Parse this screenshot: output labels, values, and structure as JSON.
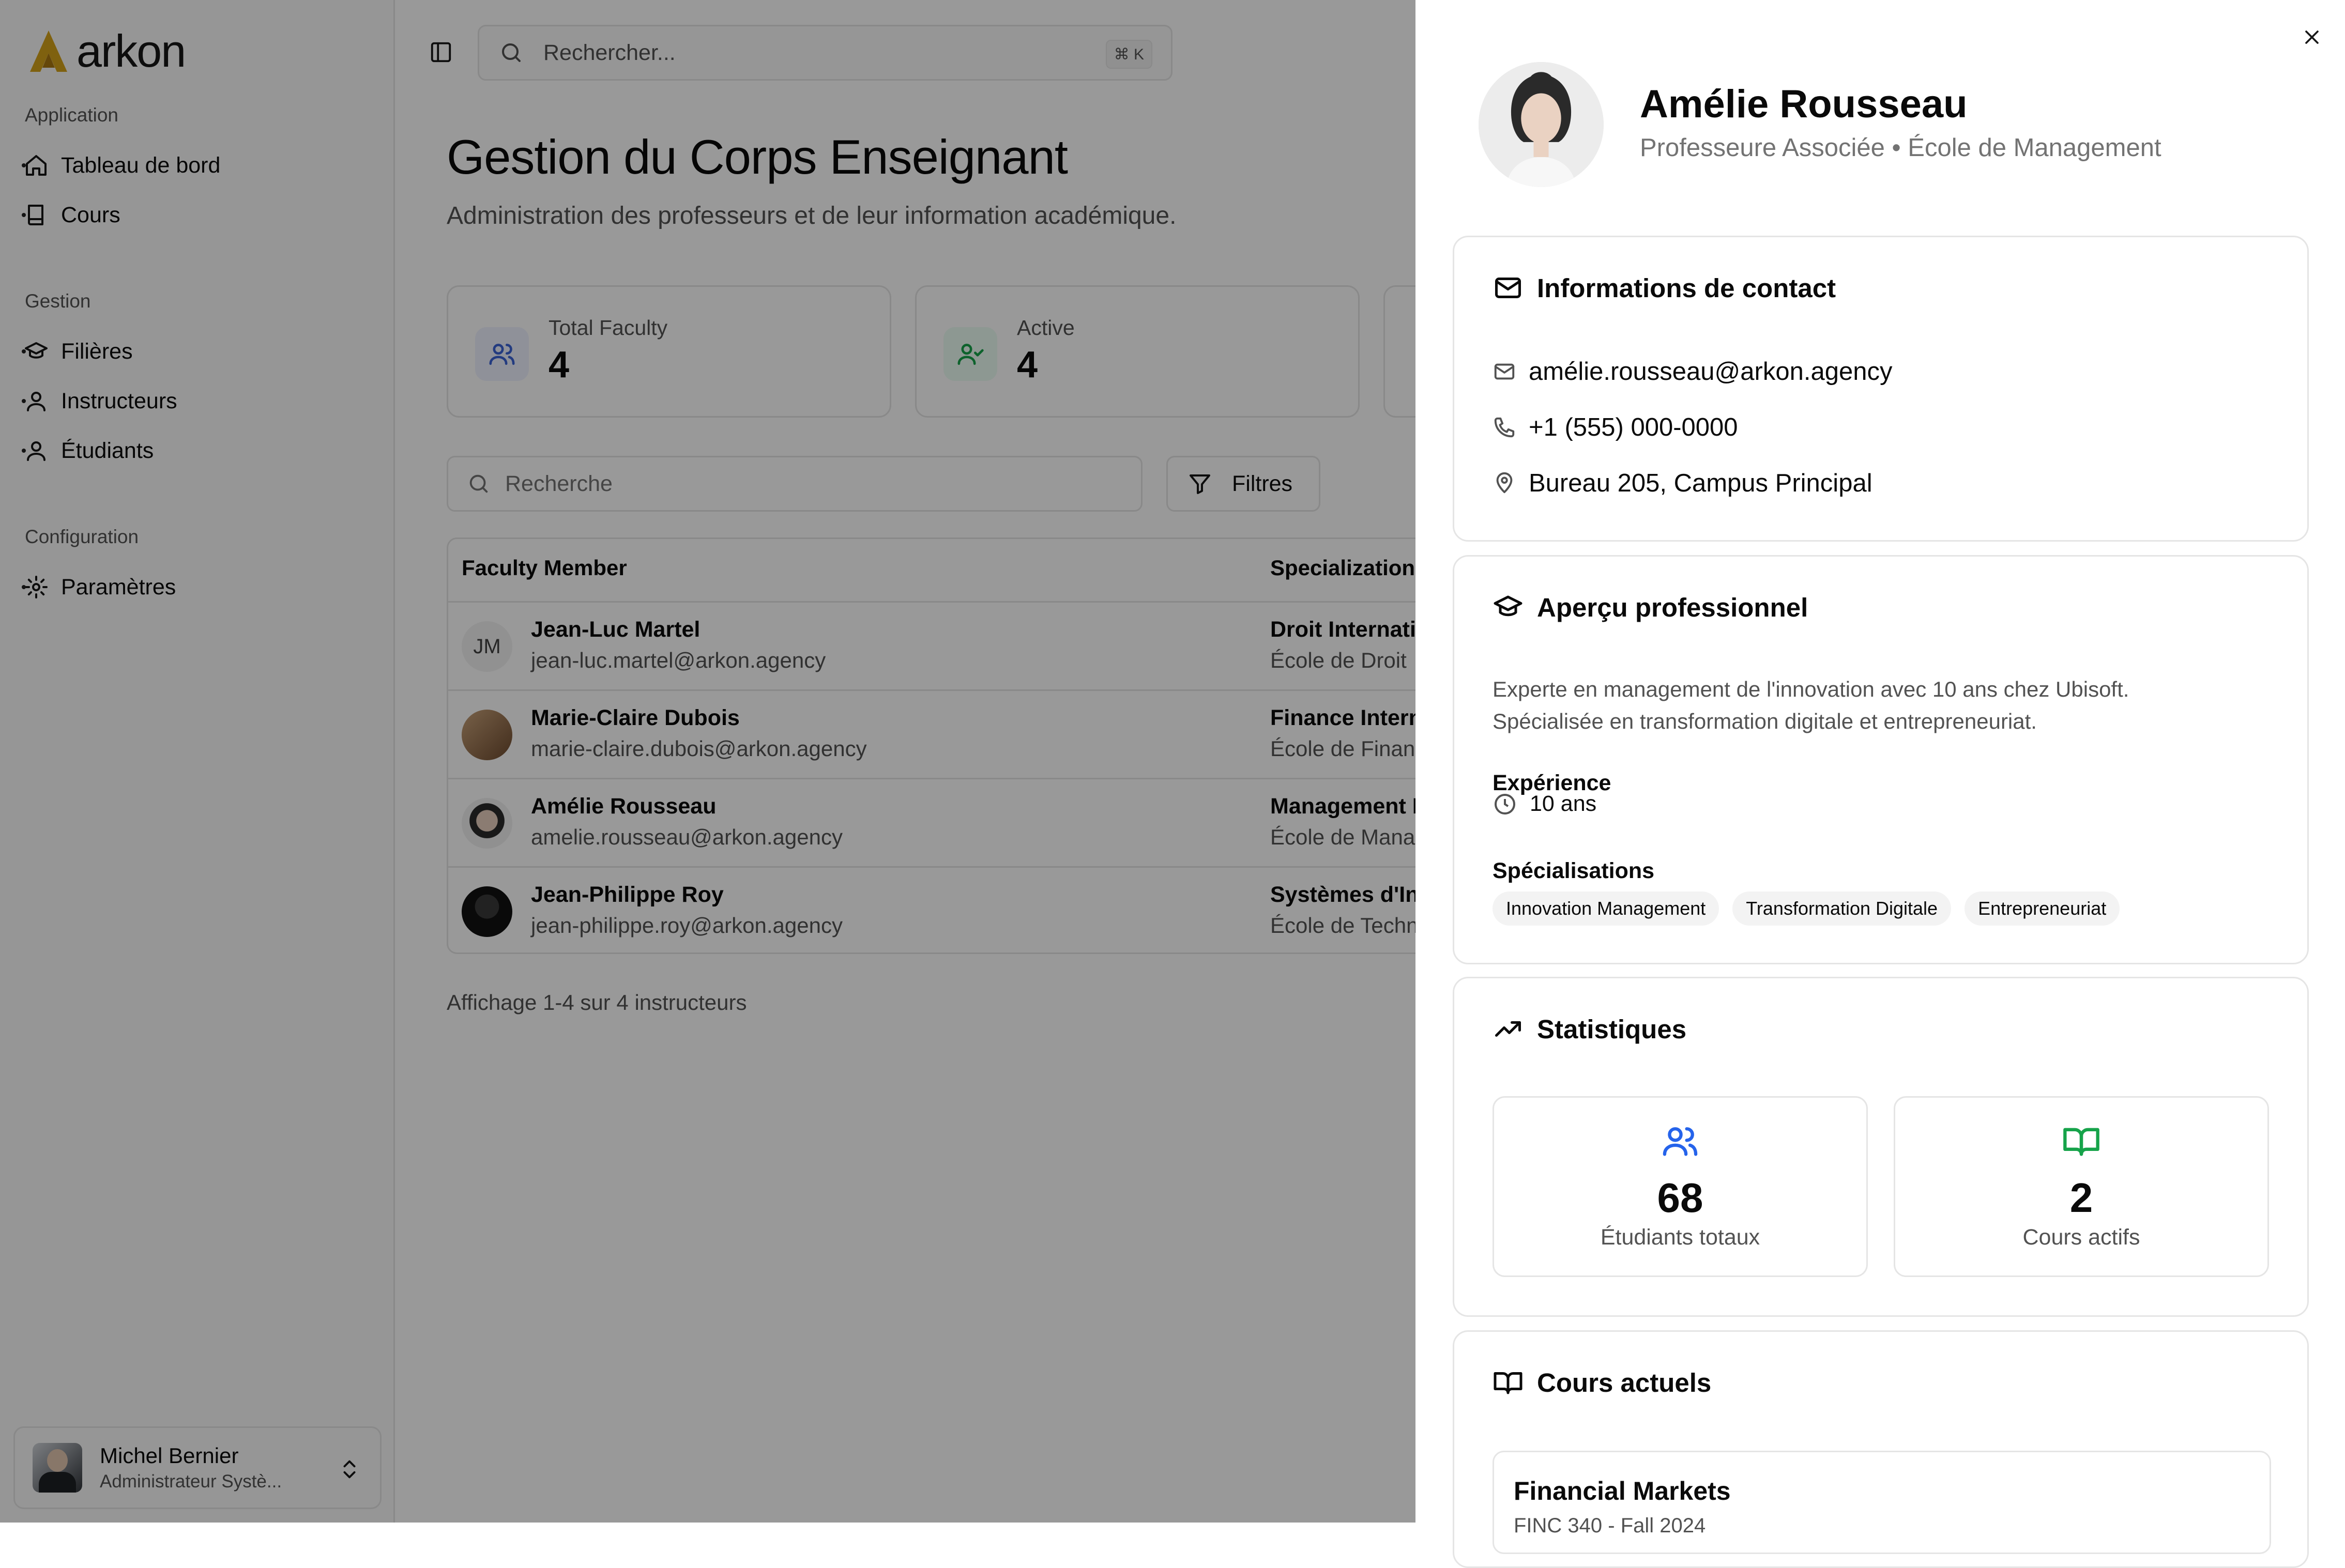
{
  "brand": {
    "name": "arkon",
    "accent": "#d4a21a"
  },
  "sidebar": {
    "sections": [
      {
        "label": "Application",
        "items": [
          {
            "label": "Tableau de bord",
            "icon": "home-icon"
          },
          {
            "label": "Cours",
            "icon": "book-icon"
          }
        ]
      },
      {
        "label": "Gestion",
        "items": [
          {
            "label": "Filières",
            "icon": "graduation-cap-icon"
          },
          {
            "label": "Instructeurs",
            "icon": "user-icon"
          },
          {
            "label": "Étudiants",
            "icon": "user-icon"
          }
        ]
      },
      {
        "label": "Configuration",
        "items": [
          {
            "label": "Paramètres",
            "icon": "gear-icon"
          }
        ]
      }
    ],
    "user": {
      "name": "Michel Bernier",
      "role": "Administrateur Systè..."
    }
  },
  "topbar": {
    "search_placeholder": "Rechercher...",
    "shortcut": "⌘ K"
  },
  "page": {
    "title": "Gestion du Corps Enseignant",
    "subtitle": "Administration des professeurs et de leur information académique."
  },
  "stats": [
    {
      "label": "Total Faculty",
      "value": "4",
      "color": "#3b63d6",
      "bg": "#eef2ff",
      "icon": "users-icon"
    },
    {
      "label": "Active",
      "value": "4",
      "color": "#16a34a",
      "bg": "#ecfdf3",
      "icon": "user-check-icon"
    }
  ],
  "filters": {
    "search_placeholder": "Recherche",
    "filter_label": "Filtres"
  },
  "table": {
    "headers": [
      "Faculty Member",
      "Specialization"
    ],
    "rows": [
      {
        "initials": "JM",
        "name": "Jean-Luc Martel",
        "email": "jean-luc.martel@arkon.agency",
        "spec": "Droit Internati",
        "school": "École de Droit"
      },
      {
        "initials": "",
        "name": "Marie-Claire Dubois",
        "email": "marie-claire.dubois@arkon.agency",
        "spec": "Finance Intern",
        "school": "École de Finan"
      },
      {
        "initials": "",
        "name": "Amélie Rousseau",
        "email": "amelie.rousseau@arkon.agency",
        "spec": "Management I",
        "school": "École de Mana"
      },
      {
        "initials": "",
        "name": "Jean-Philippe Roy",
        "email": "jean-philippe.roy@arkon.agency",
        "spec": "Systèmes d'In",
        "school": "École de Techn"
      }
    ],
    "footer": "Affichage 1-4 sur 4 instructeurs"
  },
  "panel": {
    "name": "Amélie Rousseau",
    "subtitle": "Professeure Associée • École de Management",
    "contact": {
      "title": "Informations de contact",
      "email": "amélie.rousseau@arkon.agency",
      "phone": "+1 (555) 000-0000",
      "office": "Bureau 205, Campus Principal"
    },
    "overview": {
      "title": "Aperçu professionnel",
      "bio": "Experte en management de l'innovation avec 10 ans chez Ubisoft. Spécialisée en transformation digitale et entrepreneuriat.",
      "experience_label": "Expérience",
      "experience_value": "10 ans",
      "specializations_label": "Spécialisations",
      "tags": [
        "Innovation Management",
        "Transformation Digitale",
        "Entrepreneuriat"
      ]
    },
    "statistics": {
      "title": "Statistiques",
      "students_value": "68",
      "students_label": "Étudiants totaux",
      "courses_value": "2",
      "courses_label": "Cours actifs",
      "students_color": "#2563eb",
      "courses_color": "#16a34a"
    },
    "current_courses": {
      "title": "Cours actuels",
      "items": [
        {
          "name": "Financial Markets",
          "code": "FINC 340 - Fall 2024"
        }
      ]
    }
  }
}
